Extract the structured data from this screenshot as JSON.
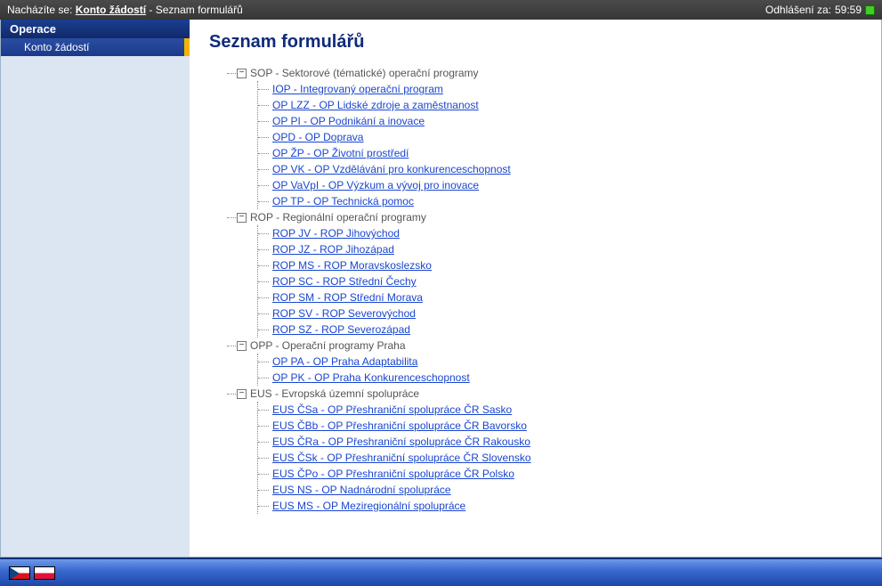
{
  "topbar": {
    "prefix": "Nacházíte se: ",
    "link": "Konto žádostí",
    "sep": " - ",
    "current": "Seznam formulářů",
    "logout_label": "Odhlášení za:",
    "logout_time": "59:59"
  },
  "sidebar": {
    "heading": "Operace",
    "items": [
      "Konto žádostí"
    ]
  },
  "page": {
    "title": "Seznam formulářů"
  },
  "tree": [
    {
      "label": "SOP - Sektorové (tématické) operační programy",
      "children": [
        "IOP - Integrovaný operační program",
        "OP LZZ - OP Lidské zdroje a zaměstnanost",
        "OP PI - OP Podnikání a inovace",
        "OPD - OP Doprava",
        "OP ŽP - OP Životní prostředí",
        "OP VK - OP Vzdělávání pro konkurenceschopnost",
        "OP VaVpI - OP Výzkum a vývoj pro inovace",
        "OP TP - OP Technická pomoc"
      ]
    },
    {
      "label": "ROP - Regionální operační programy",
      "children": [
        "ROP JV - ROP Jihovýchod",
        "ROP JZ - ROP Jihozápad",
        "ROP MS - ROP Moravskoslezsko",
        "ROP SC - ROP Střední Čechy",
        "ROP SM - ROP Střední Morava",
        "ROP SV - ROP Severovýchod",
        "ROP SZ - ROP Severozápad"
      ]
    },
    {
      "label": "OPP - Operační programy Praha",
      "children": [
        "OP PA - OP Praha Adaptabilita",
        "OP PK - OP Praha Konkurenceschopnost"
      ]
    },
    {
      "label": "EUS - Evropská územní spolupráce",
      "children": [
        "EUS ČSa - OP Přeshraniční spolupráce ČR Sasko",
        "EUS ČBb - OP Přeshraniční spolupráce ČR Bavorsko",
        "EUS ČRa - OP Přeshraniční spolupráce ČR Rakousko",
        "EUS ČSk - OP Přeshraniční spolupráce ČR Slovensko",
        "EUS ČPo - OP Přeshraniční spolupráce ČR Polsko",
        "EUS NS - OP Nadnárodní spolupráce",
        "EUS MS - OP Meziregionální spolupráce"
      ]
    }
  ]
}
